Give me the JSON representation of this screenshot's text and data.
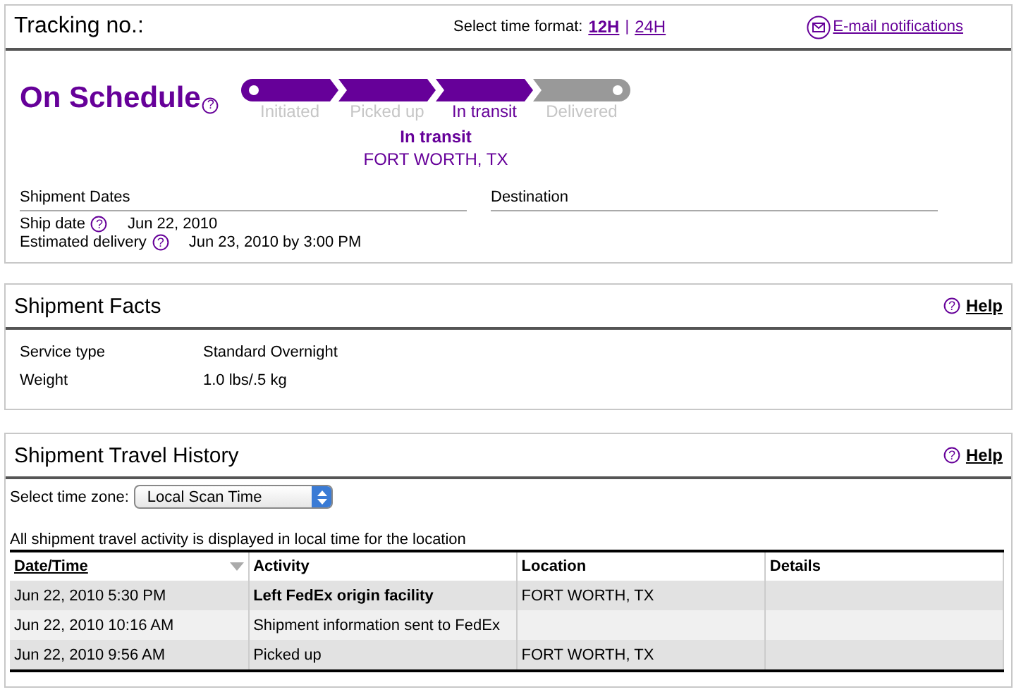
{
  "tracking": {
    "label": "Tracking no.:",
    "time_format_label": "Select time format:",
    "time_formats": [
      {
        "label": "12H",
        "selected": true
      },
      {
        "label": "24H",
        "selected": false
      }
    ],
    "separator": "|",
    "email_link": "E-mail notifications"
  },
  "status": {
    "title": "On Schedule",
    "help": "?",
    "steps": [
      {
        "label": "Initiated",
        "reached": true,
        "selected": false
      },
      {
        "label": "Picked up",
        "reached": true,
        "selected": false
      },
      {
        "label": "In transit",
        "reached": true,
        "selected": true
      },
      {
        "label": "Delivered",
        "reached": false,
        "selected": false
      }
    ],
    "current": "In transit",
    "location": "FORT WORTH, TX"
  },
  "dates": {
    "heading": "Shipment Dates",
    "rows": [
      {
        "label": "Ship date",
        "help": "?",
        "value": "Jun 22, 2010"
      },
      {
        "label": "Estimated delivery",
        "help": "?",
        "value": "Jun 23, 2010 by 3:00 PM"
      }
    ]
  },
  "destination": {
    "heading": "Destination"
  },
  "facts": {
    "title": "Shipment Facts",
    "help_mark": "?",
    "help": "Help",
    "rows": [
      {
        "label": "Service type",
        "value": "Standard Overnight"
      },
      {
        "label": "Weight",
        "value": "1.0 lbs/.5 kg"
      }
    ]
  },
  "history": {
    "title": "Shipment Travel History",
    "help_mark": "?",
    "help": "Help",
    "timezone_label": "Select time zone:",
    "timezone_value": "Local Scan Time",
    "note": "All shipment travel activity is displayed in local time for the location",
    "columns": [
      {
        "label": "Date/Time",
        "sorted": true
      },
      {
        "label": "Activity",
        "sorted": false
      },
      {
        "label": "Location",
        "sorted": false
      },
      {
        "label": "Details",
        "sorted": false
      }
    ],
    "rows": [
      {
        "date": "Jun 22, 2010 5:30 PM",
        "activity": "Left FedEx origin facility",
        "location": "FORT WORTH, TX",
        "highlight": true
      },
      {
        "date": "Jun 22, 2010 10:16 AM",
        "activity": "Shipment information sent to FedEx",
        "highlight": false
      },
      {
        "date": "Jun 22, 2010 9:56 AM",
        "activity": "Picked up",
        "location": "FORT WORTH, TX",
        "highlight": false
      }
    ]
  }
}
